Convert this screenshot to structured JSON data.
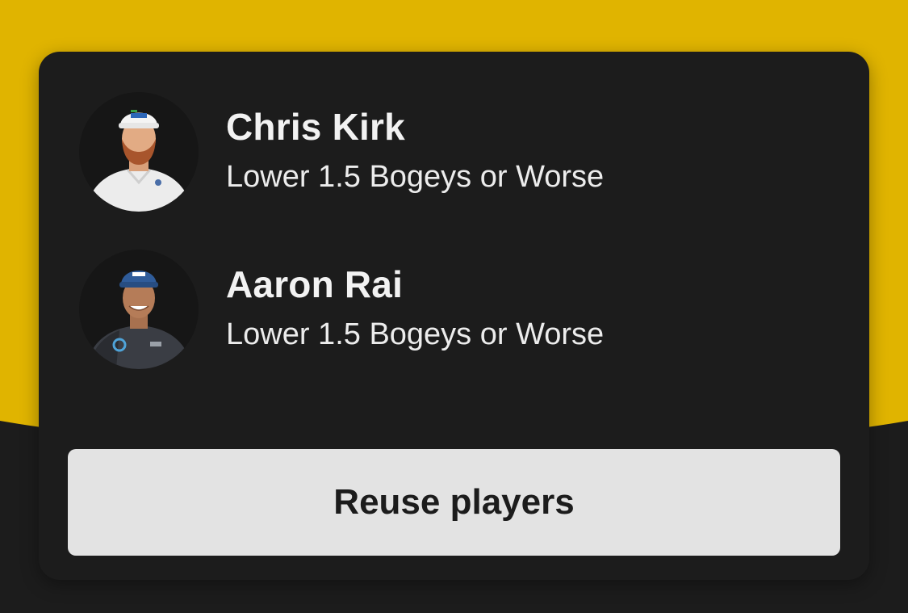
{
  "players": [
    {
      "name": "Chris Kirk",
      "pick": "Lower 1.5 Bogeys or Worse",
      "avatar_icon": "player-headshot"
    },
    {
      "name": "Aaron Rai",
      "pick": "Lower 1.5 Bogeys or Worse",
      "avatar_icon": "player-headshot"
    }
  ],
  "actions": {
    "reuse_label": "Reuse players"
  },
  "colors": {
    "accent_yellow": "#e0b400",
    "card_bg": "#1c1c1c",
    "button_bg": "#e3e3e3",
    "text_primary": "#f2f2f2"
  }
}
